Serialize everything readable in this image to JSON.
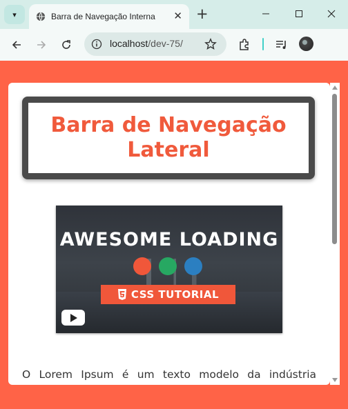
{
  "browser": {
    "tab_title": "Barra de Navegação Interna",
    "url_host": "localhost",
    "url_path": "/dev-75/"
  },
  "page": {
    "heading_line1": "Barra de Navegação",
    "heading_line2": "Lateral",
    "video": {
      "title": "AWESOME LOADING",
      "badge": "CSS TUTORIAL",
      "dot_colors": [
        "#f0573a",
        "#27a862",
        "#2b7fc1"
      ]
    },
    "paragraph": "O Lorem Ipsum é um texto modelo da indústria"
  },
  "colors": {
    "accent": "#ff6347",
    "heading": "#f05a3c",
    "frame": "#4a4a4a"
  }
}
